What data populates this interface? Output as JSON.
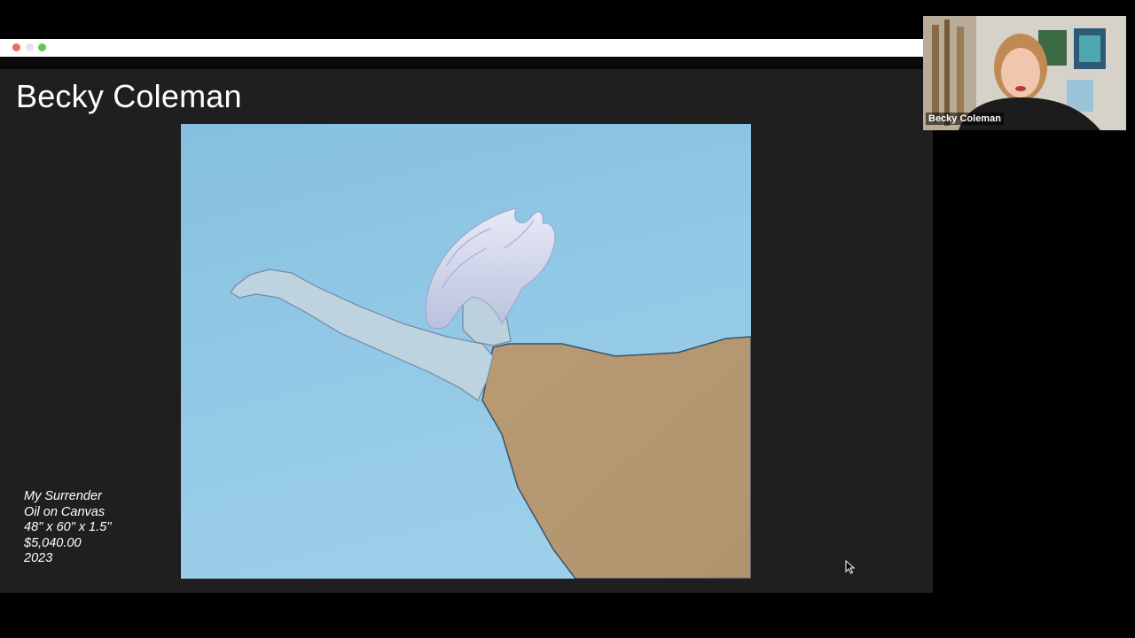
{
  "presentation": {
    "artist_title": "Becky Coleman",
    "caption": {
      "artwork_title": "My Surrender",
      "medium": "Oil on Canvas",
      "dimensions": "48\" x 60\" x 1.5\"",
      "price": "$5,040.00",
      "year": "2023"
    }
  },
  "video": {
    "participant_name": "Becky Coleman"
  },
  "colors": {
    "sky": "#8cc5e3",
    "dress": "#b79a72",
    "slide_bg": "#1f1f1f"
  }
}
